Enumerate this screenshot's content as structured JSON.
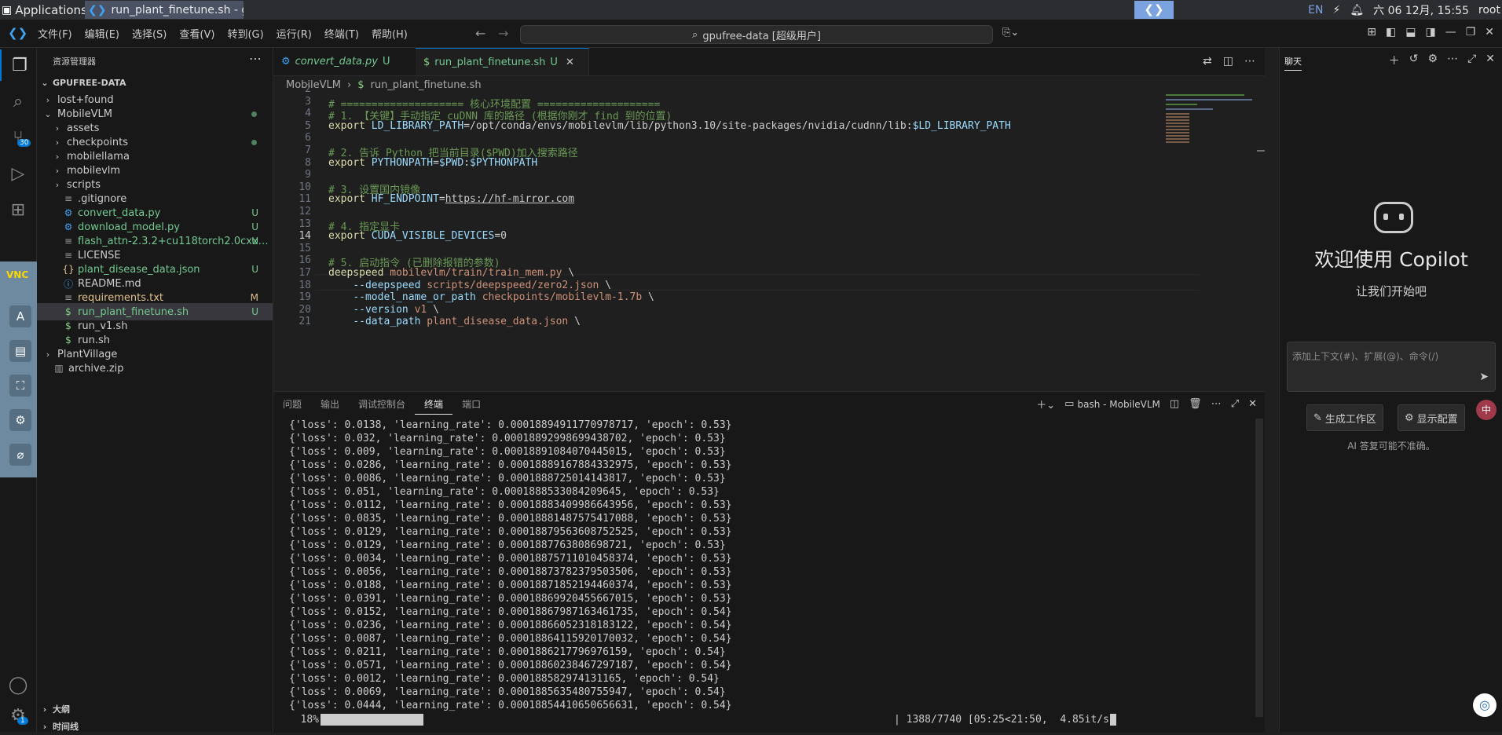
{
  "os": {
    "applications_label": "Applications",
    "task_title": "run_plant_finetune.sh - g…",
    "lang": "EN",
    "datetime": "六 06 12月, 15:55",
    "user": "root"
  },
  "menubar": [
    "文件(F)",
    "编辑(E)",
    "选择(S)",
    "查看(V)",
    "转到(G)",
    "运行(R)",
    "终端(T)",
    "帮助(H)"
  ],
  "search_text": "gpufree-data [超级用户]",
  "activity": {
    "scm_badge": "30",
    "settings_badge": "1"
  },
  "explorer": {
    "title": "资源管理器",
    "root": "GPUFREE-DATA",
    "items": [
      {
        "name": "lost+found",
        "kind": "folder",
        "status": ""
      },
      {
        "name": "MobileVLM",
        "kind": "folder-open",
        "status": "dot"
      },
      {
        "name": "assets",
        "kind": "folder",
        "status": ""
      },
      {
        "name": "checkpoints",
        "kind": "folder",
        "status": "dot"
      },
      {
        "name": "mobilellama",
        "kind": "folder",
        "status": ""
      },
      {
        "name": "mobilevlm",
        "kind": "folder",
        "status": ""
      },
      {
        "name": "scripts",
        "kind": "folder",
        "status": ""
      },
      {
        "name": ".gitignore",
        "kind": "file",
        "status": ""
      },
      {
        "name": "convert_data.py",
        "kind": "py",
        "status": "U"
      },
      {
        "name": "download_model.py",
        "kind": "py",
        "status": "U"
      },
      {
        "name": "flash_attn-2.3.2+cu118torch2.0cxx…",
        "kind": "file",
        "status": "U"
      },
      {
        "name": "LICENSE",
        "kind": "file",
        "status": ""
      },
      {
        "name": "plant_disease_data.json",
        "kind": "json",
        "status": "U"
      },
      {
        "name": "README.md",
        "kind": "md",
        "status": ""
      },
      {
        "name": "requirements.txt",
        "kind": "txt",
        "status": "M"
      },
      {
        "name": "run_plant_finetune.sh",
        "kind": "sh",
        "status": "U"
      },
      {
        "name": "run_v1.sh",
        "kind": "sh",
        "status": ""
      },
      {
        "name": "run.sh",
        "kind": "sh",
        "status": ""
      },
      {
        "name": "PlantVillage",
        "kind": "folder",
        "status": ""
      },
      {
        "name": "archive.zip",
        "kind": "zip",
        "status": ""
      }
    ],
    "outline": "大纲",
    "timeline": "时间线"
  },
  "tabs": [
    {
      "label": "convert_data.py",
      "status": "U"
    },
    {
      "label": "run_plant_finetune.sh",
      "status": "U"
    }
  ],
  "breadcrumb": [
    "MobileVLM",
    "run_plant_finetune.sh"
  ],
  "code_lines": [
    {
      "n": "2",
      "parts": []
    },
    {
      "n": "3",
      "parts": [
        {
          "c": "cm",
          "t": "# ==================== 核心环境配置 ===================="
        }
      ]
    },
    {
      "n": "4",
      "parts": [
        {
          "c": "cm",
          "t": "# 1. 【关键】手动指定 cuDNN 库的路径 (根据你刚才 find 到的位置)"
        }
      ]
    },
    {
      "n": "5",
      "parts": [
        {
          "c": "kw",
          "t": "export"
        },
        {
          "c": "",
          "t": " "
        },
        {
          "c": "vr",
          "t": "LD_LIBRARY_PATH"
        },
        {
          "c": "",
          "t": "=/opt/conda/envs/mobilevlm/lib/python3.10/site-packages/nvidia/cudnn/lib:"
        },
        {
          "c": "vr",
          "t": "$LD_LIBRARY_PATH"
        }
      ]
    },
    {
      "n": "6",
      "parts": []
    },
    {
      "n": "7",
      "parts": [
        {
          "c": "cm",
          "t": "# 2. 告诉 Python 把当前目录($PWD)加入搜索路径"
        }
      ]
    },
    {
      "n": "8",
      "parts": [
        {
          "c": "kw",
          "t": "export"
        },
        {
          "c": "",
          "t": " "
        },
        {
          "c": "vr",
          "t": "PYTHONPATH"
        },
        {
          "c": "",
          "t": "="
        },
        {
          "c": "vr",
          "t": "$PWD"
        },
        {
          "c": "",
          "t": ":"
        },
        {
          "c": "vr",
          "t": "$PYTHONPATH"
        }
      ]
    },
    {
      "n": "9",
      "parts": []
    },
    {
      "n": "10",
      "parts": [
        {
          "c": "cm",
          "t": "# 3. 设置国内镜像"
        }
      ]
    },
    {
      "n": "11",
      "parts": [
        {
          "c": "kw",
          "t": "export"
        },
        {
          "c": "",
          "t": " "
        },
        {
          "c": "vr",
          "t": "HF_ENDPOINT"
        },
        {
          "c": "",
          "t": "="
        },
        {
          "c": "url",
          "t": "https://hf-mirror.com"
        }
      ]
    },
    {
      "n": "12",
      "parts": []
    },
    {
      "n": "13",
      "parts": [
        {
          "c": "cm",
          "t": "# 4. 指定显卡"
        }
      ]
    },
    {
      "n": "14",
      "parts": [
        {
          "c": "kw",
          "t": "export"
        },
        {
          "c": "",
          "t": " "
        },
        {
          "c": "vr",
          "t": "CUDA_VISIBLE_DEVICES"
        },
        {
          "c": "",
          "t": "=0"
        }
      ]
    },
    {
      "n": "15",
      "parts": []
    },
    {
      "n": "16",
      "parts": [
        {
          "c": "cm",
          "t": "# 5. 启动指令 (已删除报错的参数)"
        }
      ]
    },
    {
      "n": "17",
      "parts": [
        {
          "c": "kw",
          "t": "deepspeed"
        },
        {
          "c": "",
          "t": " "
        },
        {
          "c": "st",
          "t": "mobilevlm/train/train_mem.py"
        },
        {
          "c": "",
          "t": " \\"
        }
      ]
    },
    {
      "n": "18",
      "parts": [
        {
          "c": "",
          "t": "    "
        },
        {
          "c": "vr",
          "t": "--deepspeed"
        },
        {
          "c": "",
          "t": " "
        },
        {
          "c": "st",
          "t": "scripts/deepspeed/zero2.json"
        },
        {
          "c": "",
          "t": " \\"
        }
      ]
    },
    {
      "n": "19",
      "parts": [
        {
          "c": "",
          "t": "    "
        },
        {
          "c": "vr",
          "t": "--model_name_or_path"
        },
        {
          "c": "",
          "t": " "
        },
        {
          "c": "st",
          "t": "checkpoints/mobilevlm-1.7b"
        },
        {
          "c": "",
          "t": " \\"
        }
      ]
    },
    {
      "n": "20",
      "parts": [
        {
          "c": "",
          "t": "    "
        },
        {
          "c": "vr",
          "t": "--version"
        },
        {
          "c": "",
          "t": " "
        },
        {
          "c": "st",
          "t": "v1"
        },
        {
          "c": "",
          "t": " \\"
        }
      ]
    },
    {
      "n": "21",
      "parts": [
        {
          "c": "",
          "t": "    "
        },
        {
          "c": "vr",
          "t": "--data_path"
        },
        {
          "c": "",
          "t": " "
        },
        {
          "c": "st",
          "t": "plant_disease_data.json"
        },
        {
          "c": "",
          "t": " \\"
        }
      ]
    }
  ],
  "panel": {
    "tabs": [
      "问题",
      "输出",
      "调试控制台",
      "终端",
      "端口"
    ],
    "active_tab": "终端",
    "terminal_name": "bash - MobileVLM",
    "lines": [
      "{'loss': 0.0138, 'learning_rate': 0.00018894911770978717, 'epoch': 0.53}",
      "{'loss': 0.032, 'learning_rate': 0.00018892998699438702, 'epoch': 0.53}",
      "{'loss': 0.009, 'learning_rate': 0.00018891084070445015, 'epoch': 0.53}",
      "{'loss': 0.0286, 'learning_rate': 0.00018889167884332975, 'epoch': 0.53}",
      "{'loss': 0.0086, 'learning_rate': 0.0001888725014143817, 'epoch': 0.53}",
      "{'loss': 0.051, 'learning_rate': 0.0001888533084209645, 'epoch': 0.53}",
      "{'loss': 0.0112, 'learning_rate': 0.00018883409986643956, 'epoch': 0.53}",
      "{'loss': 0.0835, 'learning_rate': 0.00018881487575417088, 'epoch': 0.53}",
      "{'loss': 0.0129, 'learning_rate': 0.00018879563608752525, 'epoch': 0.53}",
      "{'loss': 0.0129, 'learning_rate': 0.0001887763808698721, 'epoch': 0.53}",
      "{'loss': 0.0034, 'learning_rate': 0.00018875711010458374, 'epoch': 0.53}",
      "{'loss': 0.0056, 'learning_rate': 0.00018873782379503506, 'epoch': 0.53}",
      "{'loss': 0.0188, 'learning_rate': 0.00018871852194460374, 'epoch': 0.53}",
      "{'loss': 0.0391, 'learning_rate': 0.00018869920455667015, 'epoch': 0.53}",
      "{'loss': 0.0152, 'learning_rate': 0.00018867987163461735, 'epoch': 0.54}",
      "{'loss': 0.0236, 'learning_rate': 0.00018866052318183122, 'epoch': 0.54}",
      "{'loss': 0.0087, 'learning_rate': 0.00018864115920170032, 'epoch': 0.54}",
      "{'loss': 0.0211, 'learning_rate': 0.0001886217796976159, 'epoch': 0.54}",
      "{'loss': 0.0571, 'learning_rate': 0.00018860238467297187, 'epoch': 0.54}",
      "{'loss': 0.0012, 'learning_rate': 0.000188582974131165, 'epoch': 0.54}",
      "{'loss': 0.0069, 'learning_rate': 0.0001885635480755947, 'epoch': 0.54}",
      "{'loss': 0.0444, 'learning_rate': 0.00018854410650656631, 'epoch': 0.54}"
    ],
    "progress_pct": "18%",
    "progress_fraction": 0.18,
    "progress_text": "| 1388/7740 [05:25<21:50,  4.85it/s"
  },
  "chat": {
    "title": "聊天",
    "welcome": "欢迎使用 Copilot",
    "subtitle": "让我们开始吧",
    "placeholder": "添加上下文(#)、扩展(@)、命令(/)",
    "btn_workspace": "生成工作区",
    "btn_config": "显示配置",
    "disclaimer": "AI 答复可能不准确。"
  },
  "vnc_logo": "VNC",
  "colors": {
    "accent": "#0078d4",
    "untracked": "#73c991",
    "modified": "#e2c08d"
  }
}
